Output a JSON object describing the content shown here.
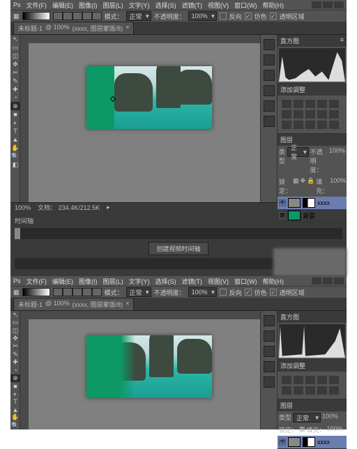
{
  "menus": [
    "文件(F)",
    "编辑(E)",
    "图像(I)",
    "图层(L)",
    "文字(Y)",
    "选择(S)",
    "滤镜(T)",
    "视图(V)",
    "窗口(W)",
    "帮助(H)"
  ],
  "optionsbar": {
    "mode_label": "模式：",
    "mode_value": "正常",
    "opacity_label": "不透明度：",
    "opacity_value": "100%",
    "reverse_label": "反向",
    "dither_label": "仿色",
    "transparency_label": "透明区域"
  },
  "tab": {
    "filename": "未标题-1",
    "zoom": "@ 100%",
    "layer_info": "(xxxx, 图层蒙版/8)"
  },
  "tools": [
    "↖",
    "▭",
    "◫",
    "✥",
    "✂",
    "✎",
    "✚",
    "◔",
    "⊕",
    "■",
    "◐",
    "T",
    "▲",
    "✋",
    "🔍",
    "⬚",
    "◧",
    "↺"
  ],
  "dock_tabs": [
    "nav",
    "color",
    "swatches",
    "history",
    "actions",
    "paragraph",
    "char"
  ],
  "panel_histogram": {
    "title": "直方图"
  },
  "panel_adjustments": {
    "title": "添加调整"
  },
  "panel_layers": {
    "title": "图层",
    "blend_label": "类型",
    "blend_value": "正常",
    "opacity_label": "不透明度：",
    "opacity_value": "100%",
    "lock_label": "锁定：",
    "fill_label": "填充：",
    "fill_value": "100%",
    "layer1_name": "xxxx",
    "layer2_name": "背景"
  },
  "statusbar": {
    "zoom": "100%",
    "doc_label": "文档：",
    "doc_size": "234.4K/212.5K"
  },
  "timeline": {
    "title": "时间轴",
    "create_btn": "创建视频时间轴"
  }
}
